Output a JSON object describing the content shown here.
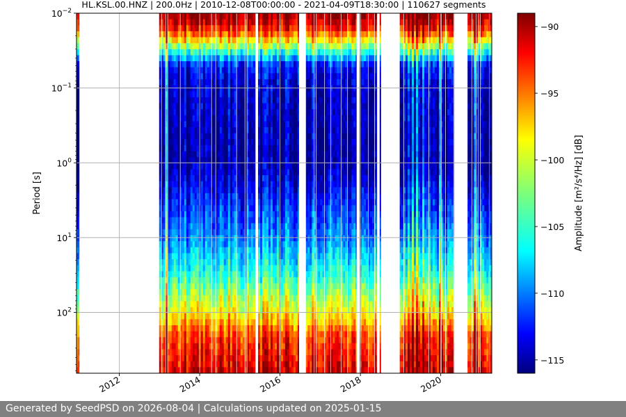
{
  "footer": {
    "text": "Generated by SeedPSD on 2026-08-04 | Calculations updated on 2025-01-15"
  },
  "chart_data": {
    "type": "heatmap",
    "title": "HL.KSL.00.HNZ | 200.0Hz | 2010-12-08T00:00:00 - 2021-04-09T18:30:00 | 110627 segments",
    "xlabel": "",
    "ylabel": "Period [s]",
    "colorbar_label": "Amplitude [m²/s⁴/Hz] [dB]",
    "x_scale": "time",
    "y_scale": "log",
    "y_inverted": true,
    "grid": true,
    "colormap": "jet",
    "xlim": [
      "2010-12-08",
      "2021-04-09"
    ],
    "ylim": [
      0.01,
      650
    ],
    "clim": [
      -116,
      -89
    ],
    "x_ticks": [
      {
        "value": "2012-01-01",
        "label": "2012"
      },
      {
        "value": "2014-01-01",
        "label": "2014"
      },
      {
        "value": "2016-01-01",
        "label": "2016"
      },
      {
        "value": "2018-01-01",
        "label": "2018"
      },
      {
        "value": "2020-01-01",
        "label": "2020"
      }
    ],
    "y_ticks": [
      {
        "value": 0.01,
        "base": "10",
        "exp": "−2"
      },
      {
        "value": 0.1,
        "base": "10",
        "exp": "−1"
      },
      {
        "value": 1,
        "base": "10",
        "exp": "0"
      },
      {
        "value": 10,
        "base": "10",
        "exp": "1"
      },
      {
        "value": 100,
        "base": "10",
        "exp": "2"
      }
    ],
    "colorbar_ticks": [
      {
        "value": -90,
        "label": "−90"
      },
      {
        "value": -95,
        "label": "−95"
      },
      {
        "value": -100,
        "label": "−100"
      },
      {
        "value": -105,
        "label": "−105"
      },
      {
        "value": -110,
        "label": "−110"
      },
      {
        "value": -115,
        "label": "−115"
      }
    ],
    "data_periods": [
      {
        "start": "2010-12-08",
        "end": "2011-01-01"
      },
      {
        "start": "2012-12-28",
        "end": "2015-05-20"
      },
      {
        "start": "2015-06-15",
        "end": "2016-06-20"
      },
      {
        "start": "2016-08-20",
        "end": "2017-11-25"
      },
      {
        "start": "2017-12-25",
        "end": "2018-05-30"
      },
      {
        "start": "2018-06-25",
        "end": "2018-07-05"
      },
      {
        "start": "2018-12-20",
        "end": "2020-05-01"
      },
      {
        "start": "2020-09-01",
        "end": "2021-03-15"
      },
      {
        "start": "2021-03-20",
        "end": "2021-04-09"
      }
    ],
    "amplitude_profile": [
      {
        "period": 0.01,
        "db": -89
      },
      {
        "period": 0.015,
        "db": -92
      },
      {
        "period": 0.02,
        "db": -96
      },
      {
        "period": 0.03,
        "db": -103
      },
      {
        "period": 0.05,
        "db": -112
      },
      {
        "period": 0.1,
        "db": -114
      },
      {
        "period": 1,
        "db": -115
      },
      {
        "period": 3,
        "db": -112
      },
      {
        "period": 10,
        "db": -109
      },
      {
        "period": 30,
        "db": -105
      },
      {
        "period": 100,
        "db": -99
      },
      {
        "period": 200,
        "db": -94
      },
      {
        "period": 650,
        "db": -91
      }
    ]
  }
}
